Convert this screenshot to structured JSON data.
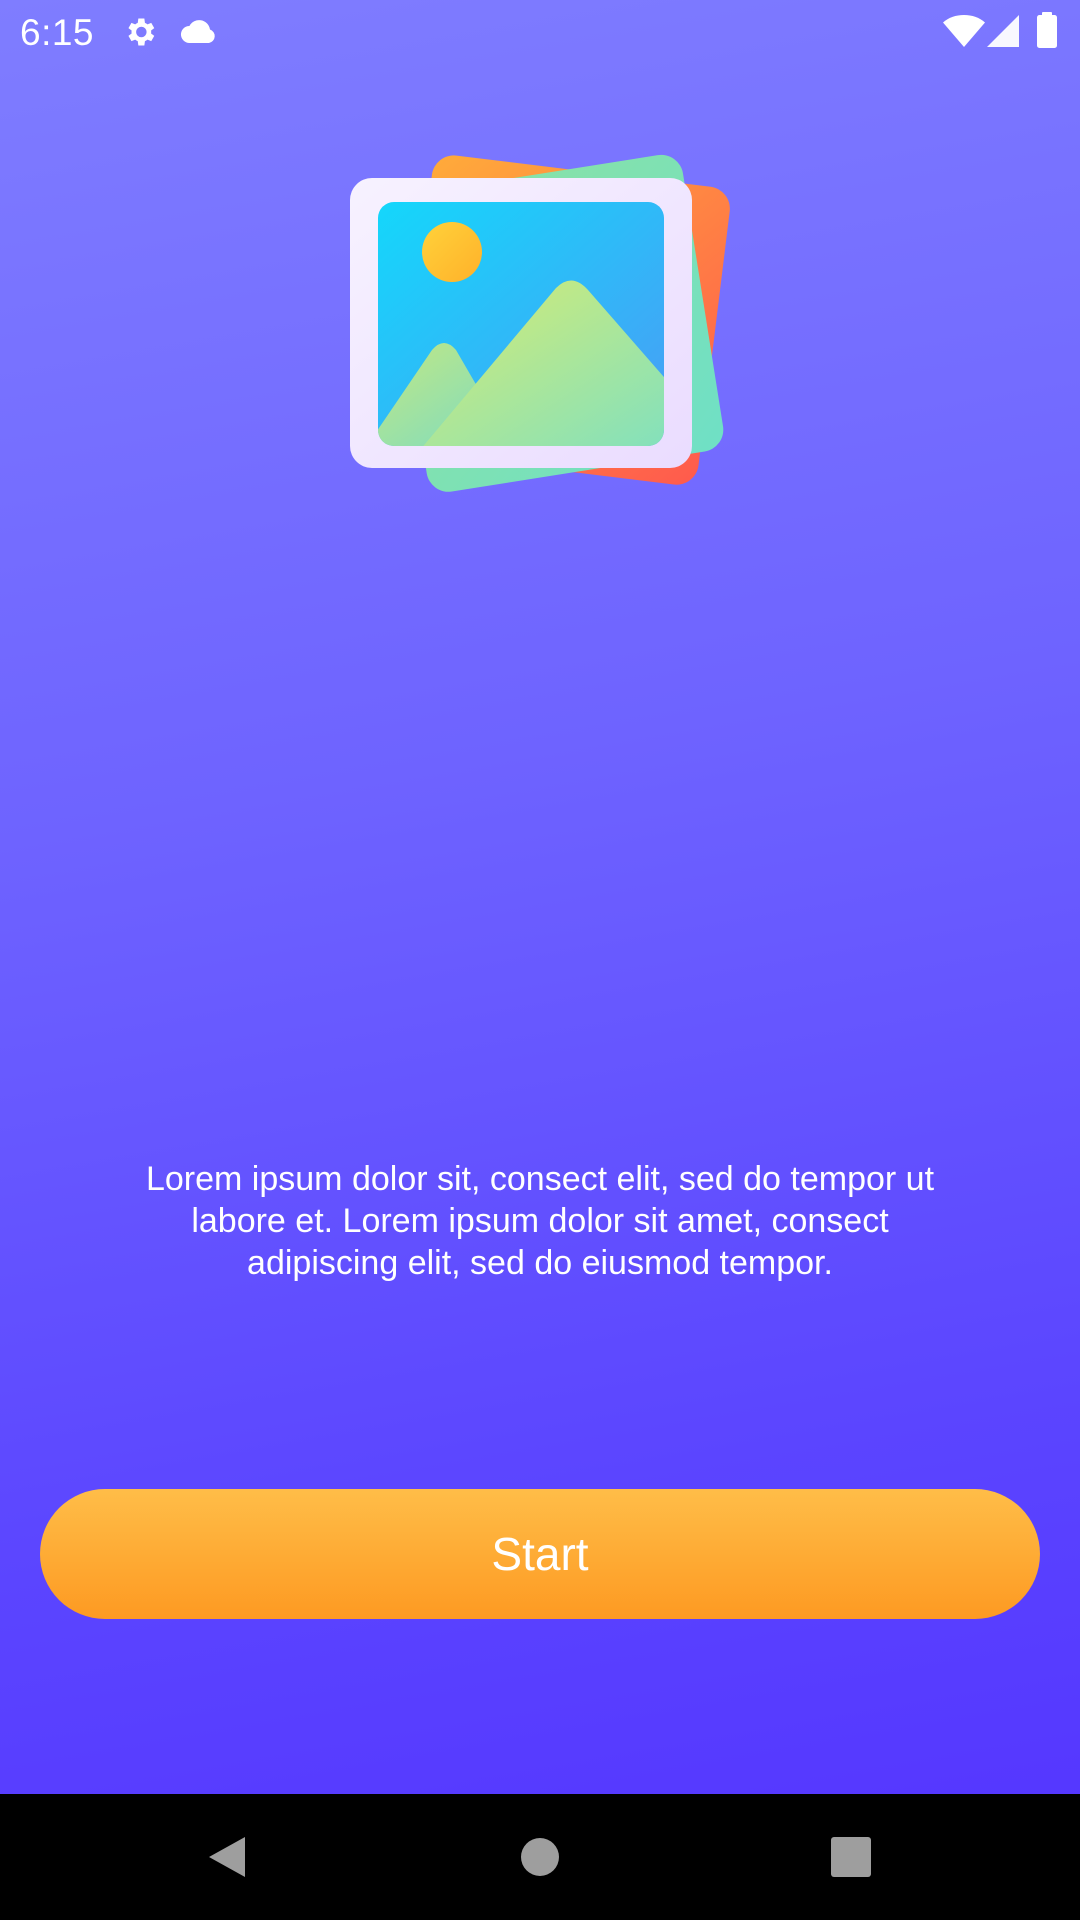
{
  "status_bar": {
    "time": "6:15",
    "icons": [
      "gear-icon",
      "cloud-icon",
      "wifi-icon",
      "cell-signal-icon",
      "battery-icon"
    ]
  },
  "hero": {
    "icon": "photo-gallery-icon"
  },
  "description": {
    "line1": "Lorem ipsum dolor sit, consect elit, sed do tempor ut",
    "line2": "labore et. Lorem ipsum dolor sit amet, consect",
    "line3": "adipiscing elit, sed do eiusmod tempor."
  },
  "start_button": {
    "label": "Start"
  },
  "nav_bar": {
    "icons": [
      "back-icon",
      "home-icon",
      "recents-icon"
    ]
  },
  "colors": {
    "background_top": "#7f7dff",
    "background_bottom": "#5333ff",
    "button_top": "#ffbd48",
    "button_bottom": "#fd9a22",
    "nav_bar": "#000000"
  }
}
